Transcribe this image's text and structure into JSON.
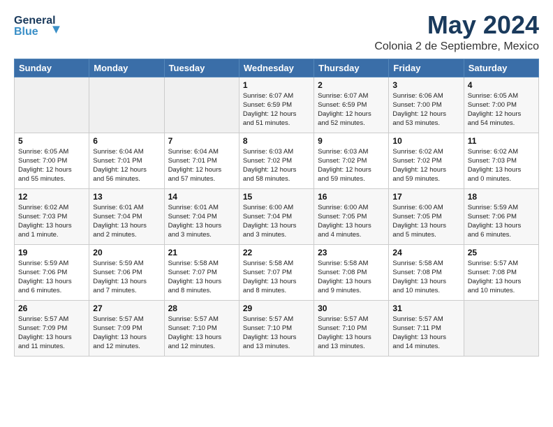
{
  "header": {
    "logo_line1": "General",
    "logo_line2": "Blue",
    "month": "May 2024",
    "location": "Colonia 2 de Septiembre, Mexico"
  },
  "weekdays": [
    "Sunday",
    "Monday",
    "Tuesday",
    "Wednesday",
    "Thursday",
    "Friday",
    "Saturday"
  ],
  "weeks": [
    [
      {
        "day": "",
        "info": ""
      },
      {
        "day": "",
        "info": ""
      },
      {
        "day": "",
        "info": ""
      },
      {
        "day": "1",
        "info": "Sunrise: 6:07 AM\nSunset: 6:59 PM\nDaylight: 12 hours\nand 51 minutes."
      },
      {
        "day": "2",
        "info": "Sunrise: 6:07 AM\nSunset: 6:59 PM\nDaylight: 12 hours\nand 52 minutes."
      },
      {
        "day": "3",
        "info": "Sunrise: 6:06 AM\nSunset: 7:00 PM\nDaylight: 12 hours\nand 53 minutes."
      },
      {
        "day": "4",
        "info": "Sunrise: 6:05 AM\nSunset: 7:00 PM\nDaylight: 12 hours\nand 54 minutes."
      }
    ],
    [
      {
        "day": "5",
        "info": "Sunrise: 6:05 AM\nSunset: 7:00 PM\nDaylight: 12 hours\nand 55 minutes."
      },
      {
        "day": "6",
        "info": "Sunrise: 6:04 AM\nSunset: 7:01 PM\nDaylight: 12 hours\nand 56 minutes."
      },
      {
        "day": "7",
        "info": "Sunrise: 6:04 AM\nSunset: 7:01 PM\nDaylight: 12 hours\nand 57 minutes."
      },
      {
        "day": "8",
        "info": "Sunrise: 6:03 AM\nSunset: 7:02 PM\nDaylight: 12 hours\nand 58 minutes."
      },
      {
        "day": "9",
        "info": "Sunrise: 6:03 AM\nSunset: 7:02 PM\nDaylight: 12 hours\nand 59 minutes."
      },
      {
        "day": "10",
        "info": "Sunrise: 6:02 AM\nSunset: 7:02 PM\nDaylight: 12 hours\nand 59 minutes."
      },
      {
        "day": "11",
        "info": "Sunrise: 6:02 AM\nSunset: 7:03 PM\nDaylight: 13 hours\nand 0 minutes."
      }
    ],
    [
      {
        "day": "12",
        "info": "Sunrise: 6:02 AM\nSunset: 7:03 PM\nDaylight: 13 hours\nand 1 minute."
      },
      {
        "day": "13",
        "info": "Sunrise: 6:01 AM\nSunset: 7:04 PM\nDaylight: 13 hours\nand 2 minutes."
      },
      {
        "day": "14",
        "info": "Sunrise: 6:01 AM\nSunset: 7:04 PM\nDaylight: 13 hours\nand 3 minutes."
      },
      {
        "day": "15",
        "info": "Sunrise: 6:00 AM\nSunset: 7:04 PM\nDaylight: 13 hours\nand 3 minutes."
      },
      {
        "day": "16",
        "info": "Sunrise: 6:00 AM\nSunset: 7:05 PM\nDaylight: 13 hours\nand 4 minutes."
      },
      {
        "day": "17",
        "info": "Sunrise: 6:00 AM\nSunset: 7:05 PM\nDaylight: 13 hours\nand 5 minutes."
      },
      {
        "day": "18",
        "info": "Sunrise: 5:59 AM\nSunset: 7:06 PM\nDaylight: 13 hours\nand 6 minutes."
      }
    ],
    [
      {
        "day": "19",
        "info": "Sunrise: 5:59 AM\nSunset: 7:06 PM\nDaylight: 13 hours\nand 6 minutes."
      },
      {
        "day": "20",
        "info": "Sunrise: 5:59 AM\nSunset: 7:06 PM\nDaylight: 13 hours\nand 7 minutes."
      },
      {
        "day": "21",
        "info": "Sunrise: 5:58 AM\nSunset: 7:07 PM\nDaylight: 13 hours\nand 8 minutes."
      },
      {
        "day": "22",
        "info": "Sunrise: 5:58 AM\nSunset: 7:07 PM\nDaylight: 13 hours\nand 8 minutes."
      },
      {
        "day": "23",
        "info": "Sunrise: 5:58 AM\nSunset: 7:08 PM\nDaylight: 13 hours\nand 9 minutes."
      },
      {
        "day": "24",
        "info": "Sunrise: 5:58 AM\nSunset: 7:08 PM\nDaylight: 13 hours\nand 10 minutes."
      },
      {
        "day": "25",
        "info": "Sunrise: 5:57 AM\nSunset: 7:08 PM\nDaylight: 13 hours\nand 10 minutes."
      }
    ],
    [
      {
        "day": "26",
        "info": "Sunrise: 5:57 AM\nSunset: 7:09 PM\nDaylight: 13 hours\nand 11 minutes."
      },
      {
        "day": "27",
        "info": "Sunrise: 5:57 AM\nSunset: 7:09 PM\nDaylight: 13 hours\nand 12 minutes."
      },
      {
        "day": "28",
        "info": "Sunrise: 5:57 AM\nSunset: 7:10 PM\nDaylight: 13 hours\nand 12 minutes."
      },
      {
        "day": "29",
        "info": "Sunrise: 5:57 AM\nSunset: 7:10 PM\nDaylight: 13 hours\nand 13 minutes."
      },
      {
        "day": "30",
        "info": "Sunrise: 5:57 AM\nSunset: 7:10 PM\nDaylight: 13 hours\nand 13 minutes."
      },
      {
        "day": "31",
        "info": "Sunrise: 5:57 AM\nSunset: 7:11 PM\nDaylight: 13 hours\nand 14 minutes."
      },
      {
        "day": "",
        "info": ""
      }
    ]
  ]
}
